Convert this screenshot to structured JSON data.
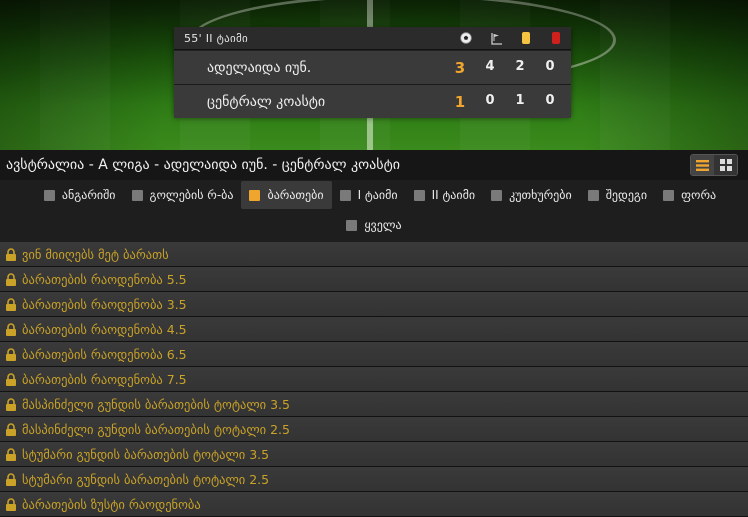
{
  "scoreboard": {
    "time": "55' II ტაიმი",
    "icons": [
      "ball-icon",
      "corner-flag-icon",
      "yellow-card-icon",
      "red-card-icon"
    ],
    "teams": [
      {
        "name": "ადელაიდა იუნ.",
        "goals": "3",
        "corners": "4",
        "yellow": "2",
        "red": "0"
      },
      {
        "name": "ცენტრალ კოასტი",
        "goals": "1",
        "corners": "0",
        "yellow": "1",
        "red": "0"
      }
    ]
  },
  "match_title": "ავსტრალია - A ლიგა - ადელაიდა იუნ. - ცენტრალ კოასტი",
  "filters": [
    {
      "label": "ანგარიში",
      "active": false
    },
    {
      "label": "გოლების რ-ბა",
      "active": false
    },
    {
      "label": "ბარათები",
      "active": true
    },
    {
      "label": "I ტაიმი",
      "active": false
    },
    {
      "label": "II ტაიმი",
      "active": false
    },
    {
      "label": "კუთხურები",
      "active": false
    },
    {
      "label": "შედეგი",
      "active": false
    },
    {
      "label": "ფორა",
      "active": false
    },
    {
      "label": "ყველა",
      "active": false
    }
  ],
  "markets": [
    "ვინ მიიღებს მეტ ბარათს",
    "ბარათების რაოდენობა 5.5",
    "ბარათების რაოდენობა 3.5",
    "ბარათების რაოდენობა 4.5",
    "ბარათების რაოდენობა 6.5",
    "ბარათების რაოდენობა 7.5",
    "მასპინძელი გუნდის ბარათების ტოტალი 3.5",
    "მასპინძელი გუნდის ბარათების ტოტალი 2.5",
    "სტუმარი გუნდის ბარათების ტოტალი 3.5",
    "სტუმარი გუნდის ბარათების ტოტალი 2.5",
    "ბარათების ზუსტი რაოდენობა"
  ],
  "colors": {
    "accent": "#f0a52e",
    "market_text": "#c9a227",
    "yellow_card": "#f5c542",
    "red_card": "#d0201b"
  }
}
